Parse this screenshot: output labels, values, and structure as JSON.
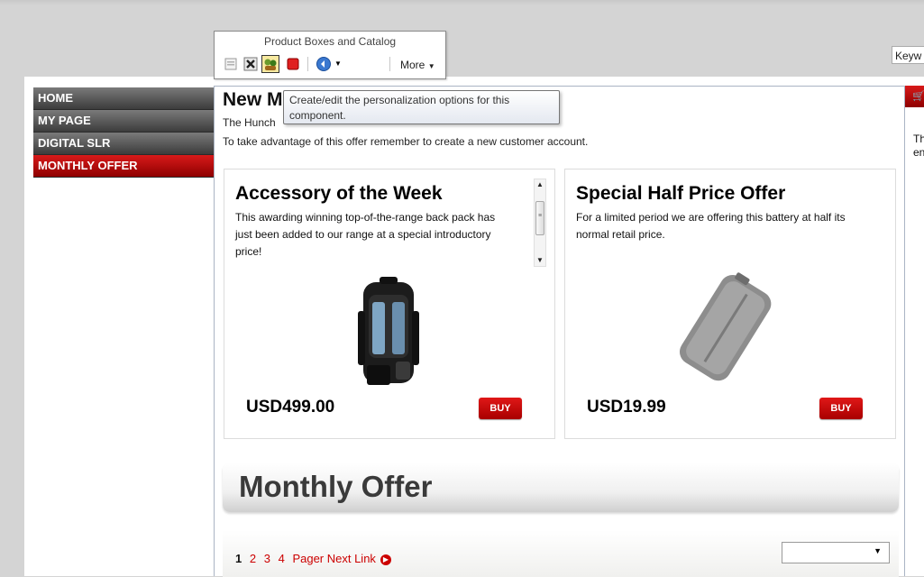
{
  "nav": {
    "items": [
      {
        "label": "HOME"
      },
      {
        "label": "MY PAGE"
      },
      {
        "label": "DIGITAL SLR"
      },
      {
        "label": "MONTHLY OFFER",
        "active": true
      }
    ]
  },
  "keyword": {
    "text": "Keyw"
  },
  "toolbar": {
    "title": "Product Boxes and Catalog",
    "icons": [
      "properties-icon",
      "delete-icon",
      "personalize-icon",
      "stop-icon",
      "history-icon"
    ],
    "more_label": "More"
  },
  "tooltip": {
    "text": "Create/edit the personalization options for this component."
  },
  "main": {
    "headline": "New M",
    "intro1": "The Hunch",
    "intro2": "To take advantage of this offer remember to create a new customer account."
  },
  "products": [
    {
      "title": "Accessory of the Week",
      "description": "This awarding winning top-of-the-range back pack has just been added to our range at a special introductory price!",
      "price": "USD499.00",
      "buy_label": "BUY",
      "image": "backpack"
    },
    {
      "title": "Special Half Price Offer",
      "description": "For a limited period we are offering this battery at half its normal retail price.",
      "price": "USD19.99",
      "buy_label": "BUY",
      "image": "battery"
    }
  ],
  "offer_banner": {
    "title": "Monthly Offer"
  },
  "pager": {
    "pages": [
      "1",
      "2",
      "3",
      "4"
    ],
    "current": "1",
    "next_label": "Pager Next Link"
  },
  "right_column": {
    "text": "Th en"
  },
  "colors": {
    "accent": "#c00000",
    "nav_dark": "#3c3c3c",
    "border": "#aab4c4"
  }
}
